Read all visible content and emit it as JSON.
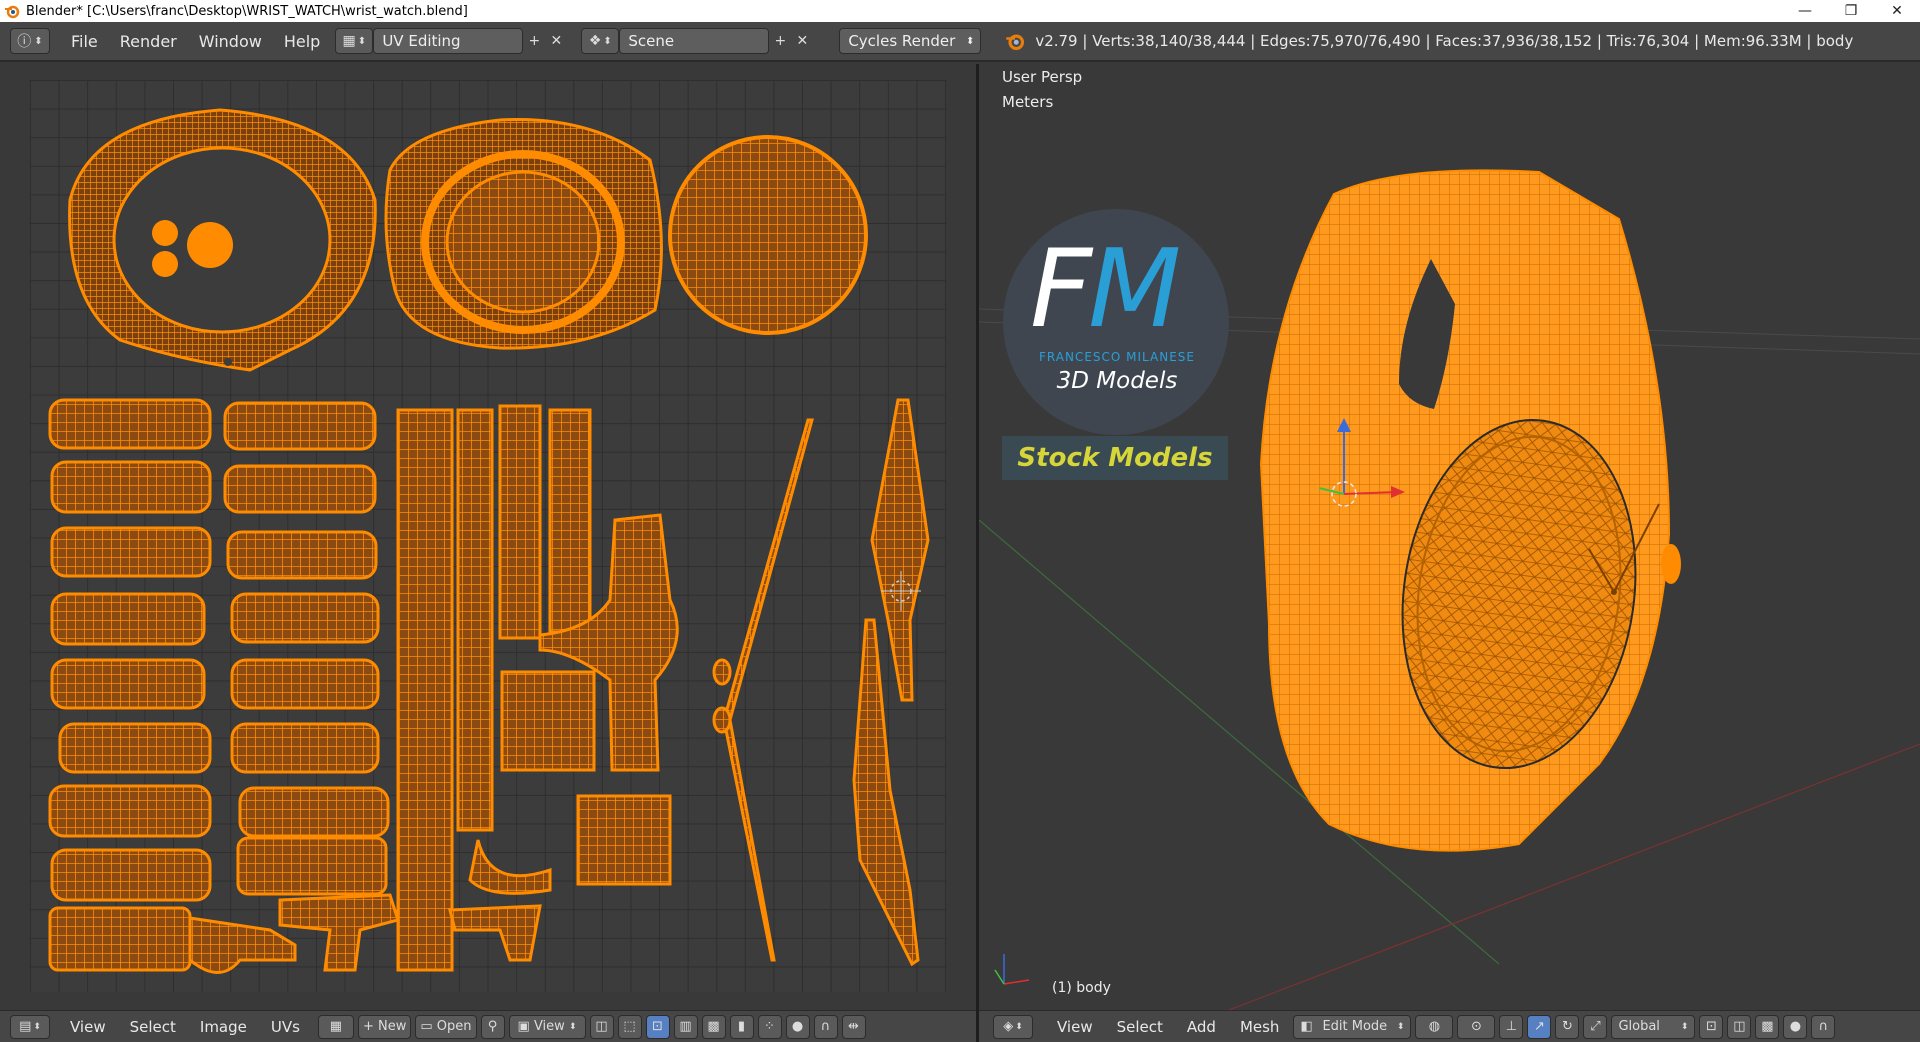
{
  "window": {
    "title": "Blender* [C:\\Users\\franc\\Desktop\\WRIST_WATCH\\wrist_watch.blend]",
    "minimize_glyph": "—",
    "restore_glyph": "❐",
    "close_glyph": "✕"
  },
  "header": {
    "info_icon": "ⓘ",
    "menus": [
      "File",
      "Render",
      "Window",
      "Help"
    ],
    "screen_layout": "UV Editing",
    "scene": "Scene",
    "render_engine": "Cycles Render",
    "stats": "v2.79 | Verts:38,140/38,444 | Edges:75,970/76,490 | Faces:37,936/38,152 | Tris:76,304 | Mem:96.33M | body",
    "add_glyph": "+",
    "remove_glyph": "✕",
    "spin_glyph": "⬍"
  },
  "uv_editor": {
    "footer_menus": [
      "View",
      "Select",
      "Image",
      "UVs"
    ],
    "new_label": "New",
    "open_label": "Open",
    "view_label": "View"
  },
  "viewport": {
    "view_name": "User Persp",
    "units": "Meters",
    "object_label": "(1) body",
    "footer_menus": [
      "View",
      "Select",
      "Add",
      "Mesh"
    ],
    "mode": "Edit Mode",
    "orientation": "Global"
  },
  "logo": {
    "letter_f": "F",
    "letter_m": "M",
    "subtitle": "FRANCESCO MILANESE",
    "tagline": "3D Models",
    "banner": "Stock Models"
  },
  "colors": {
    "mesh_orange": "#ff8c00",
    "accent_blue": "#2a9fd6",
    "banner_yellow": "#d6d63a"
  }
}
